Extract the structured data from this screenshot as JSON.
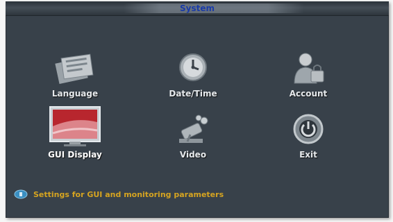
{
  "window": {
    "title": "System"
  },
  "menu": [
    {
      "label": "Language",
      "icon": "language-icon"
    },
    {
      "label": "Date/Time",
      "icon": "clock-icon"
    },
    {
      "label": "Account",
      "icon": "user-account-icon"
    },
    {
      "label": "GUI Display",
      "icon": "monitor-icon",
      "selected": true
    },
    {
      "label": "Video",
      "icon": "video-camera-icon"
    },
    {
      "label": "Exit",
      "icon": "power-icon"
    }
  ],
  "status": {
    "hint": "Settings for GUI and monitoring parameters",
    "icon": "info-icon"
  },
  "colors": {
    "panel": "#38414a",
    "title": "#1a3ba8",
    "hint": "#d6a420"
  }
}
